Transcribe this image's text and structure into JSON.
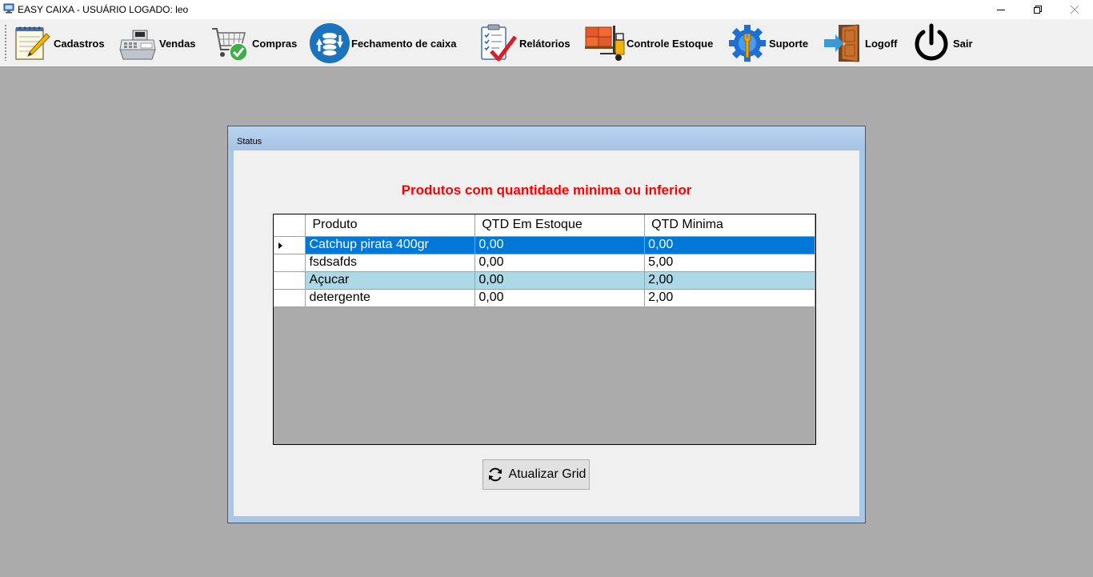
{
  "window": {
    "title": "EASY CAIXA - USUÁRIO LOGADO: leo",
    "app_icon": "computer-icon",
    "controls": {
      "minimize": "minimize-icon",
      "restore": "restore-icon",
      "close": "close-icon"
    }
  },
  "toolbar": {
    "items": [
      {
        "label": "Cadastros",
        "icon": "notepad-pencil-icon"
      },
      {
        "label": "Vendas",
        "icon": "cash-register-icon"
      },
      {
        "label": "Compras",
        "icon": "shopping-cart-check-icon"
      },
      {
        "label": "Fechamento de caixa",
        "icon": "coins-exchange-icon"
      },
      {
        "label": "Relátorios",
        "icon": "checklist-report-icon"
      },
      {
        "label": "Controle Estoque",
        "icon": "forklift-boxes-icon"
      },
      {
        "label": "Suporte",
        "icon": "gear-wrench-icon"
      },
      {
        "label": "Logoff",
        "icon": "door-exit-icon"
      },
      {
        "label": "Sair",
        "icon": "power-icon"
      }
    ]
  },
  "status_window": {
    "title": "Status",
    "heading": "Produtos com quantidade minima ou inferior",
    "heading_color": "#ff0000",
    "grid": {
      "columns": [
        "Produto",
        "QTD Em Estoque",
        "QTD Minima"
      ],
      "rows": [
        {
          "produto": "Catchup pirata 400gr",
          "qtd_estoque": "0,00",
          "qtd_minima": "0,00"
        },
        {
          "produto": "fsdsafds",
          "qtd_estoque": "0,00",
          "qtd_minima": "5,00"
        },
        {
          "produto": "Açucar",
          "qtd_estoque": "0,00",
          "qtd_minima": "2,00"
        },
        {
          "produto": "detergente",
          "qtd_estoque": "0,00",
          "qtd_minima": "2,00"
        }
      ],
      "selected_color": "#0078d7",
      "alt_row_color": "#add8e6"
    },
    "refresh_button": {
      "label": "Atualizar Grid",
      "icon": "refresh-icon"
    }
  }
}
